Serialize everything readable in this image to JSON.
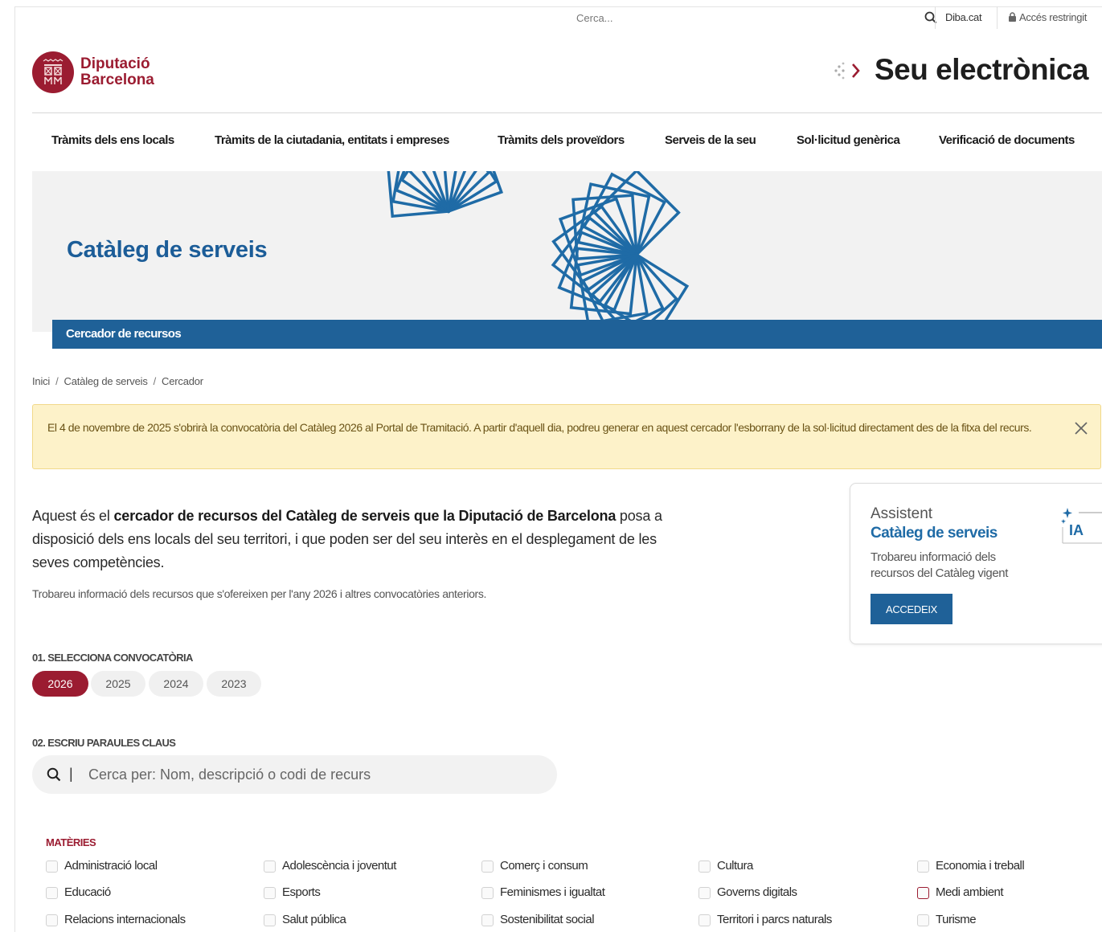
{
  "topbar": {
    "search_placeholder": "Cerca...",
    "diba_link": "Diba.cat",
    "restricted": "Accés restringit"
  },
  "header": {
    "org_line1": "Diputació",
    "org_line2": "Barcelona",
    "site_title": "Seu electrònica"
  },
  "nav": [
    "Tràmits dels ens locals",
    "Tràmits de la ciutadania, entitats i empreses",
    "Tràmits dels proveïdors",
    "Serveis de la seu",
    "Sol·licitud genèrica",
    "Verificació de documents"
  ],
  "hero": {
    "title": "Catàleg de serveis",
    "bar_label": "Cercador de recursos"
  },
  "breadcrumb": [
    "Inici",
    "Catàleg de serveis",
    "Cercador"
  ],
  "alert": {
    "text": "El 4 de novembre de 2025 s'obrirà la convocatòria del Catàleg 2026 al Portal de Tramitació. A partir d'aquell dia, podreu generar en aquest cercador l'esborrany de la sol·licitud directament des de la fitxa del recurs."
  },
  "intro": {
    "pre": "Aquest és el ",
    "bold": "cercador de recursos del Catàleg de serveis que la Diputació de Barcelona",
    "post": " posa a disposició dels ens locals del seu territori, i que poden ser del seu interès en el desplegament de les seves competències.",
    "sub": "Trobareu informació dels recursos que s'ofereixen per l'any 2026 i altres convocatòries anteriors."
  },
  "assistant": {
    "label": "Assistent",
    "title": "Catàleg de serveis",
    "desc": "Trobareu informació dels recursos del Catàleg vigent",
    "button": "ACCEDEIX",
    "badge": "IA"
  },
  "step1": {
    "label": "01. SELECCIONA CONVOCATÒRIA",
    "years": [
      "2026",
      "2025",
      "2024",
      "2023"
    ],
    "selected": "2026"
  },
  "step2": {
    "label": "02. ESCRIU PARAULES CLAUS",
    "placeholder": "Cerca per: Nom, descripció o codi de recurs",
    "pipe": "|"
  },
  "materies": {
    "label": "MATÈRIES",
    "items": [
      "Administració local",
      "Adolescència i joventut",
      "Comerç i consum",
      "Cultura",
      "Economia i treball",
      "Educació",
      "Esports",
      "Feminismes i igualtat",
      "Governs digitals",
      "Medi ambient",
      "Relacions internacionals",
      "Salut pública",
      "Sostenibilitat social",
      "Territori i parcs naturals",
      "Turisme"
    ]
  },
  "colors": {
    "brand_red": "#9b1c31",
    "brand_blue": "#1f6198",
    "alert_bg": "#fdf2c9"
  }
}
